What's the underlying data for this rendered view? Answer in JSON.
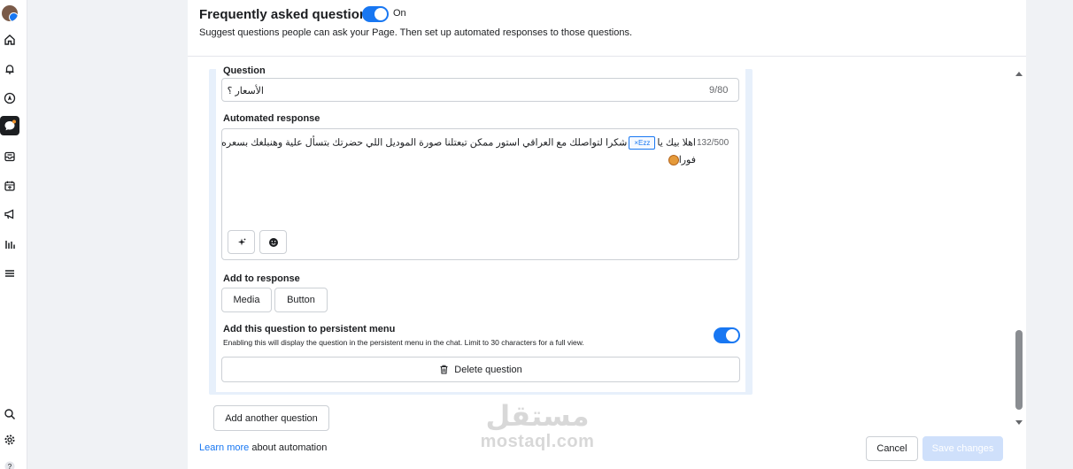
{
  "rail": {
    "items": [
      {
        "icon": "avatar"
      },
      {
        "icon": "home-icon"
      },
      {
        "icon": "bell-icon"
      },
      {
        "icon": "compass-icon"
      },
      {
        "icon": "chat-icon",
        "active": true
      },
      {
        "icon": "inbox-icon"
      },
      {
        "icon": "calendar-icon"
      },
      {
        "icon": "megaphone-icon"
      },
      {
        "icon": "bar-chart-icon"
      },
      {
        "icon": "menu-icon"
      },
      {
        "icon": "search-icon"
      },
      {
        "icon": "gear-icon"
      },
      {
        "icon": "help-icon"
      }
    ]
  },
  "header": {
    "title": "Frequently asked questions",
    "toggle_state": "On",
    "subtitle": "Suggest questions people can ask your Page. Then set up automated responses to those questions."
  },
  "question": {
    "label": "Question",
    "value": "الأسعار ؟",
    "counter": "9/80"
  },
  "automated_response": {
    "label": "Automated response",
    "counter": "132/500",
    "text_before_chip": "اهلا بيك يا",
    "chip_label": "Ezz",
    "text_after_chip": "شكرا لتواصلك مع العراقي استور  ممكن تبعتلنا صورة الموديل اللي حضرتك بتسأل علية وهنبلغك بسعره",
    "text_line2": "فورا"
  },
  "add_to_response": {
    "label": "Add to response",
    "media_label": "Media",
    "button_label": "Button"
  },
  "persistent_menu": {
    "label": "Add this question to persistent menu",
    "description": "Enabling this will display the question in the persistent menu in the chat. Limit to 30 characters for a full view.",
    "enabled": true
  },
  "delete_label": "Delete question",
  "add_another_label": "Add another question",
  "footer": {
    "learn_more": "Learn more",
    "about": " about automation",
    "cancel_label": "Cancel",
    "save_label": "Save changes"
  },
  "watermark": {
    "arabic": "مستقل",
    "latin": "mostaql.com"
  },
  "colors": {
    "accent": "#1877f2",
    "save_disabled": "#cfe0fb",
    "panel_bg": "#e7f0fb"
  }
}
